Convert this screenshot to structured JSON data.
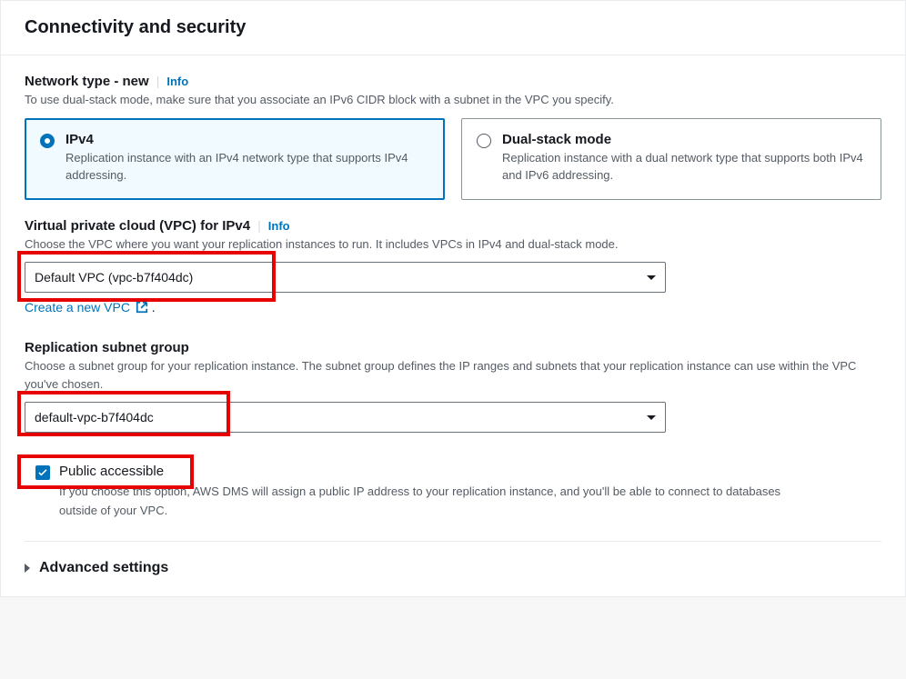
{
  "section_title": "Connectivity and security",
  "network_type": {
    "label": "Network type - new",
    "info": "Info",
    "desc": "To use dual-stack mode, make sure that you associate an IPv6 CIDR block with a subnet in the VPC you specify.",
    "options": [
      {
        "title": "IPv4",
        "desc": "Replication instance with an IPv4 network type that supports IPv4 addressing.",
        "selected": true
      },
      {
        "title": "Dual-stack mode",
        "desc": "Replication instance with a dual network type that supports both IPv4 and IPv6 addressing.",
        "selected": false
      }
    ]
  },
  "vpc": {
    "label": "Virtual private cloud (VPC) for IPv4",
    "info": "Info",
    "desc": "Choose the VPC where you want your replication instances to run. It includes VPCs in IPv4 and dual-stack mode.",
    "selected": "Default VPC (vpc-b7f404dc)",
    "create_link": "Create a new VPC",
    "period": "."
  },
  "subnet": {
    "label": "Replication subnet group",
    "desc": "Choose a subnet group for your replication instance. The subnet group defines the IP ranges and subnets that your replication instance can use within the VPC you've chosen.",
    "selected": "default-vpc-b7f404dc"
  },
  "public": {
    "label": "Public accessible",
    "desc": "If you choose this option, AWS DMS will assign a public IP address to your replication instance, and you'll be able to connect to databases outside of your VPC.",
    "checked": true
  },
  "advanced": "Advanced settings"
}
